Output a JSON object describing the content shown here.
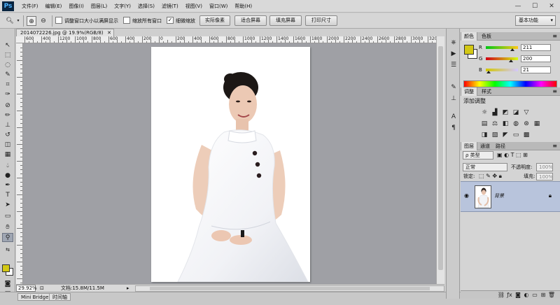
{
  "app": {
    "logo_text": "Ps",
    "menu": [
      "文件(F)",
      "编辑(E)",
      "图像(I)",
      "图层(L)",
      "文字(Y)",
      "选择(S)",
      "滤镜(T)",
      "视图(V)",
      "窗口(W)",
      "帮助(H)"
    ],
    "window_controls": [
      "—",
      "☐",
      "✕"
    ]
  },
  "options": {
    "checkbox_resize": "调整窗口大小以满屏显示",
    "checkbox_all_windows": "缩放所有窗口",
    "checkbox_scrubby": "细微缩放",
    "btn_actual_pixels": "实际像素",
    "btn_fit_screen": "适合屏幕",
    "btn_fill_screen": "填充屏幕",
    "btn_print_size": "打印尺寸",
    "workspace": "基本功能"
  },
  "document": {
    "tab_title": "2014072226.jpg @ 19.9%(RGB/8)",
    "ruler_labels": [
      "600",
      "400",
      "1200",
      "1000",
      "800",
      "600",
      "400",
      "200",
      "0",
      "200",
      "400",
      "600",
      "800",
      "1000",
      "1200",
      "1400",
      "1600",
      "1800",
      "2000",
      "2200",
      "2400",
      "2600",
      "2800",
      "3000",
      "3200",
      "3400"
    ],
    "zoom": "29.92%",
    "doc_info": "文档:15.8M/11.5M"
  },
  "bottom_tabs": [
    "Mini Bridge",
    "时间轴"
  ],
  "color_panel": {
    "tabs": [
      "颜色",
      "色板"
    ],
    "r_label": "R",
    "g_label": "G",
    "b_label": "B",
    "r_value": "211",
    "g_value": "200",
    "b_value": "21",
    "r_fraction": 0.83,
    "g_fraction": 0.78,
    "b_fraction": 0.08,
    "foreground": "#d3c815"
  },
  "adjustments_panel": {
    "tabs": [
      "调整",
      "样式"
    ],
    "title": "添加调整"
  },
  "layers_panel": {
    "tabs": [
      "图层",
      "通道",
      "路径"
    ],
    "filter_kind": "ρ 类型",
    "blend_mode": "正常",
    "opacity_label": "不透明度:",
    "opacity_value": "100%",
    "lock_label": "锁定:",
    "fill_label": "填充:",
    "fill_value": "100%",
    "layer_name": "背景"
  }
}
